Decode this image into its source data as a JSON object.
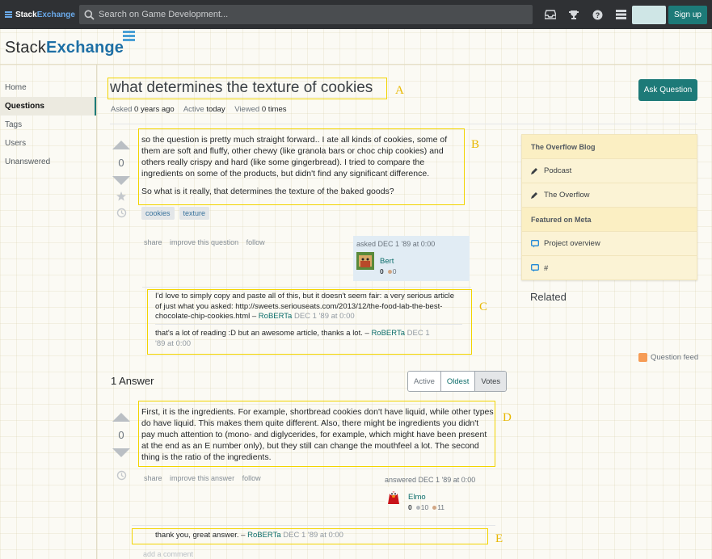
{
  "topbar": {
    "brand_prefix": "Stack",
    "brand_suffix": "Exchange",
    "search_placeholder": "Search on Game Development...",
    "signup_label": "Sign up",
    "icons": [
      "inbox-icon",
      "trophy-icon",
      "help-icon",
      "site-switcher-icon"
    ]
  },
  "header": {
    "logo_prefix": "Stack",
    "logo_suffix": "Exchange"
  },
  "leftnav": {
    "items": [
      "Home",
      "Questions",
      "Tags",
      "Users",
      "Unanswered"
    ],
    "active": "Questions"
  },
  "question": {
    "title": "what determines the texture of cookies",
    "ask_button": "Ask Question",
    "meta": {
      "asked_label": "Asked",
      "asked_value": "0 years ago",
      "active_label": "Active",
      "active_value": "today",
      "viewed_label": "Viewed",
      "viewed_value": "0 times"
    },
    "votes": "0",
    "body_p1": "so the question is pretty much straight forward.. I ate all kinds of cookies, some of them are soft and fluffy, other chewy (like granola bars or choc chip cookies) and others really crispy and hard (like some gingerbread). I tried to compare the ingredients on some of the products, but didn't find any significant difference.",
    "body_p2": "So what is it really, that determines the texture of the baked goods?",
    "tags": [
      "cookies",
      "texture"
    ],
    "menu": [
      "share",
      "improve this question",
      "follow"
    ],
    "asked": "asked DEC 1 '89 at 0:00",
    "user": {
      "name": "Bert",
      "rep": "0",
      "bronze": "0"
    },
    "comments": [
      {
        "text": "I'd love to simply copy and paste all of this, but it doesn't seem fair: a very serious article of just what you asked: http://sweets.seriouseats.com/2013/12/the-food-lab-the-best-chocolate-chip-cookies.html –",
        "author": "RoBERTa",
        "date": "DEC 1 '89 at 0:00"
      },
      {
        "text": "that's a lot of reading :D but an awesome article, thanks a lot. –",
        "author": "RoBERTa",
        "date": "DEC 1 '89 at 0:00"
      }
    ]
  },
  "sidebar": {
    "blog_header": "The Overflow Blog",
    "blog_items": [
      "Podcast",
      "The Overflow"
    ],
    "meta_header": "Featured on Meta",
    "meta_items": [
      "Project overview",
      "#"
    ],
    "related": "Related",
    "feed": "Question feed"
  },
  "answers": {
    "count_label": "1 Answer",
    "sort_tabs": [
      "Active",
      "Oldest",
      "Votes"
    ],
    "items": [
      {
        "votes": "0",
        "body": "First, it is the ingredients. For example, shortbread cookies don't have liquid, while other types do have liquid. This makes them quite different. Also, there might be ingredients you didn't pay much attention to (mono- and diglycerides, for example, which might have been present at the end as an E number only), but they still can change the mouthfeel a lot. The second thing is the ratio of the ingredients.",
        "menu": [
          "share",
          "improve this answer",
          "follow"
        ],
        "answered": "answered DEC 1 '89 at 0:00",
        "user": {
          "name": "Elmo",
          "rep": "0",
          "silver": "10",
          "bronze": "11"
        },
        "comment": {
          "text": "thank you, great answer. –",
          "author": "RoBERTa",
          "date": "DEC 1 '89 at 0:00"
        }
      }
    ],
    "add_comment": "add a comment"
  },
  "annotations": [
    "A",
    "B",
    "C",
    "D",
    "E"
  ],
  "colors": {
    "accent": "#1d7a78",
    "annotation": "#f2d400",
    "topbar": "#2f3134"
  }
}
